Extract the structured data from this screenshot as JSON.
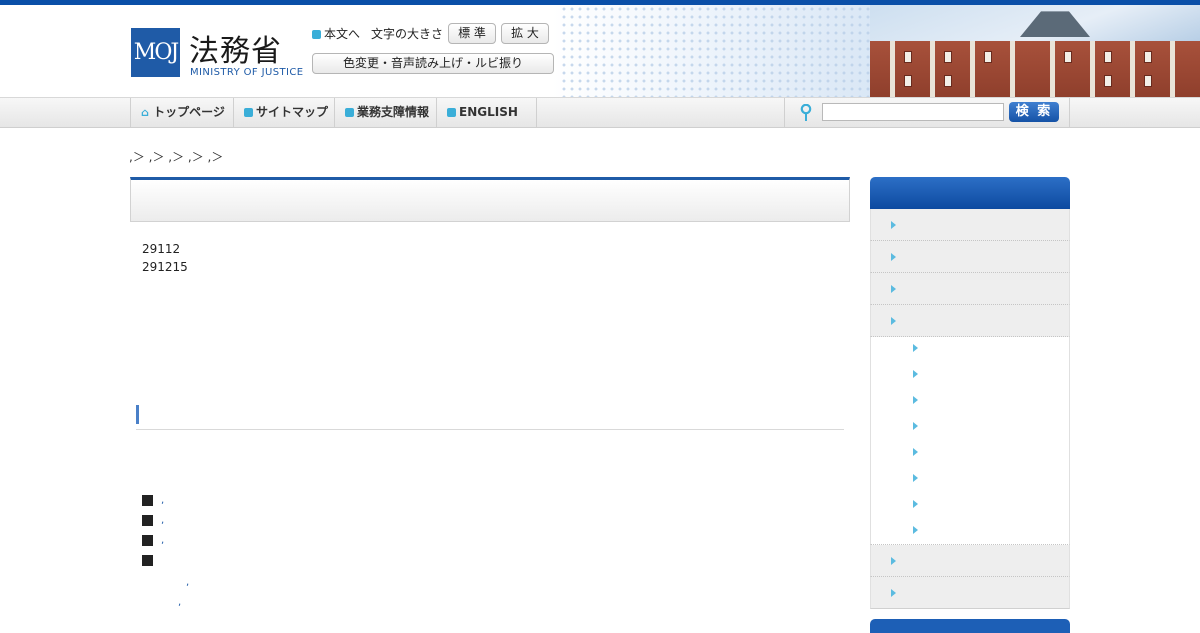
{
  "header": {
    "logo_mark": "MOJ",
    "ministry_name": "法務省",
    "ministry_sub": "MINISTRY OF JUSTICE",
    "skip_to_content": "本文へ",
    "font_size_label": "文字の大きさ",
    "font_standard": "標 準",
    "font_large": "拡 大",
    "accessibility_label": "色変更・音声読み上げ・ルビ振り"
  },
  "nav": {
    "items": [
      {
        "label": "トップページ",
        "icon": "home-icon"
      },
      {
        "label": "サイトマップ",
        "icon": "square-icon"
      },
      {
        "label": "業務支障情報",
        "icon": "square-icon"
      },
      {
        "label": "ENGLISH",
        "icon": "square-icon"
      }
    ],
    "search_icon": "pin-icon",
    "search_placeholder": "",
    "search_button": "検 索"
  },
  "breadcrumb": ",＞ ,＞ ,＞ ,＞ ,＞",
  "content": {
    "line1": "29112",
    "line2": "291215",
    "bullet_links": [
      ",",
      ",",
      ",",
      ""
    ],
    "sub_links": [
      ",",
      ","
    ]
  },
  "sidebar": {
    "item_count_top": 4,
    "sub_item_count": 8,
    "item_count_bottom": 2
  },
  "colors": {
    "brand_blue": "#1f5ba7",
    "accent_cyan": "#3aaed8"
  }
}
